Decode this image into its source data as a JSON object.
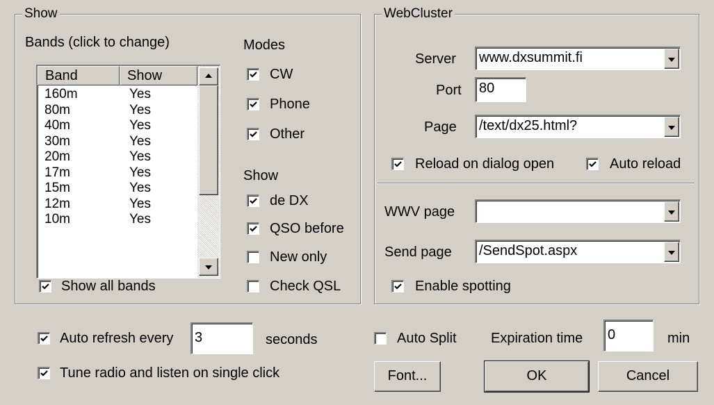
{
  "show_group": {
    "title": "Show",
    "bands_label": "Bands (click to change)",
    "columns": [
      "Band",
      "Show"
    ],
    "bands": [
      {
        "band": "160m",
        "show": "Yes"
      },
      {
        "band": "80m",
        "show": "Yes"
      },
      {
        "band": "40m",
        "show": "Yes"
      },
      {
        "band": "30m",
        "show": "Yes"
      },
      {
        "band": "20m",
        "show": "Yes"
      },
      {
        "band": "17m",
        "show": "Yes"
      },
      {
        "band": "15m",
        "show": "Yes"
      },
      {
        "band": "12m",
        "show": "Yes"
      },
      {
        "band": "10m",
        "show": "Yes"
      }
    ],
    "show_all_bands": {
      "label": "Show all bands",
      "checked": true
    },
    "modes_label": "Modes",
    "modes": [
      {
        "label": "CW",
        "checked": true
      },
      {
        "label": "Phone",
        "checked": true
      },
      {
        "label": "Other",
        "checked": true
      }
    ],
    "show_label": "Show",
    "show_options": [
      {
        "label": "de DX",
        "checked": true
      },
      {
        "label": "QSO before",
        "checked": true
      },
      {
        "label": "New only",
        "checked": false
      },
      {
        "label": "Check QSL",
        "checked": false
      }
    ]
  },
  "webcluster": {
    "title": "WebCluster",
    "server_label": "Server",
    "server_value": "www.dxsummit.fi",
    "port_label": "Port",
    "port_value": "80",
    "page_label": "Page",
    "page_value": "/text/dx25.html?",
    "reload_on_open": {
      "label": "Reload on dialog open",
      "checked": true
    },
    "auto_reload": {
      "label": "Auto reload",
      "checked": true
    },
    "wwv_label": "WWV page",
    "wwv_value": "",
    "send_label": "Send page",
    "send_value": "/SendSpot.aspx",
    "enable_spotting": {
      "label": "Enable spotting",
      "checked": true
    }
  },
  "bottom": {
    "auto_refresh_label": "Auto refresh every",
    "auto_refresh_checked": true,
    "auto_refresh_value": "3",
    "seconds_label": "seconds",
    "tune_radio_label": "Tune radio and listen on single click",
    "tune_radio_checked": true,
    "auto_split_label": "Auto Split",
    "auto_split_checked": false,
    "expiration_label": "Expiration time",
    "expiration_value": "0",
    "min_label": "min",
    "font_button": "Font...",
    "ok_button": "OK",
    "cancel_button": "Cancel"
  }
}
